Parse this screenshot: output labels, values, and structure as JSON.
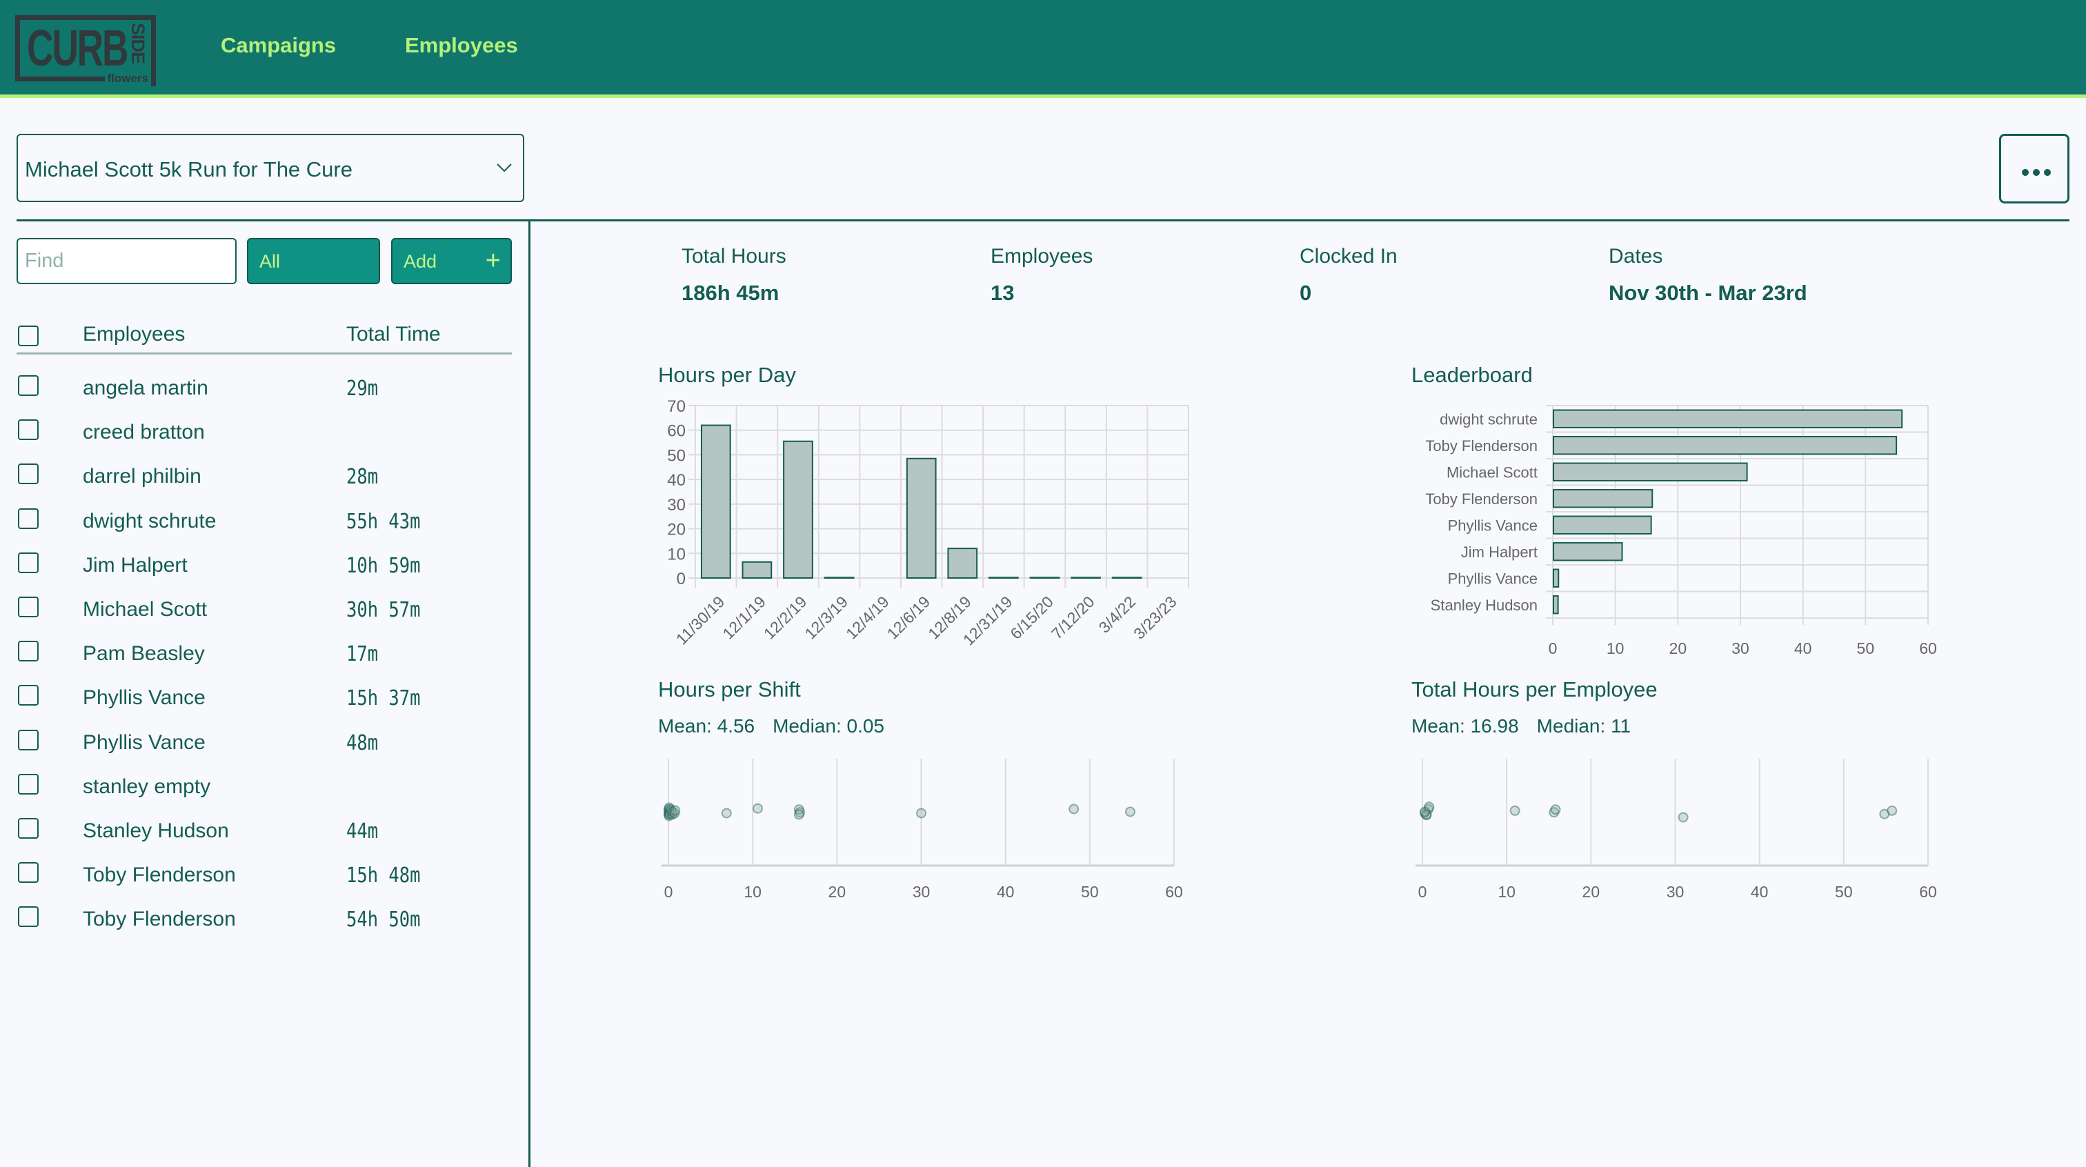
{
  "header": {
    "logo": {
      "main": "CURB",
      "side": "SIDE",
      "sub": "flowers"
    },
    "nav": [
      {
        "label": "Campaigns"
      },
      {
        "label": "Employees"
      }
    ]
  },
  "campaign_select": {
    "selected": "Michael Scott 5k Run for The Cure",
    "icon": "chevron-down-icon"
  },
  "more_button": {
    "icon": "more-horizontal-icon"
  },
  "sidebar": {
    "search": {
      "placeholder": "Find",
      "value": ""
    },
    "filter_button": {
      "label": "All"
    },
    "add_button": {
      "label": "Add",
      "icon": "plus-icon"
    },
    "columns": {
      "name": "Employees",
      "time": "Total Time"
    },
    "employees": [
      {
        "name": "angela martin",
        "time": "29m"
      },
      {
        "name": "creed bratton",
        "time": ""
      },
      {
        "name": "darrel philbin",
        "time": "28m"
      },
      {
        "name": "dwight schrute",
        "time": "55h 43m"
      },
      {
        "name": "Jim Halpert",
        "time": "10h 59m"
      },
      {
        "name": "Michael Scott",
        "time": "30h 57m"
      },
      {
        "name": "Pam Beasley",
        "time": "17m"
      },
      {
        "name": "Phyllis Vance",
        "time": "15h 37m"
      },
      {
        "name": "Phyllis Vance",
        "time": "48m"
      },
      {
        "name": "stanley empty",
        "time": ""
      },
      {
        "name": "Stanley Hudson",
        "time": "44m"
      },
      {
        "name": "Toby Flenderson",
        "time": "15h 48m"
      },
      {
        "name": "Toby Flenderson",
        "time": "54h 50m"
      }
    ]
  },
  "stats": [
    {
      "label": "Total Hours",
      "value": "186h 45m"
    },
    {
      "label": "Employees",
      "value": "13"
    },
    {
      "label": "Clocked In",
      "value": "0"
    },
    {
      "label": "Dates",
      "value": "Nov 30th - Mar 23rd"
    }
  ],
  "colors": {
    "primary": "#135d52",
    "header": "#10766c",
    "accent": "#b5f07a",
    "bar_fill": "#b5c5c3",
    "bar_stroke": "#135d52"
  },
  "chart_data": [
    {
      "id": "hours_per_day",
      "type": "bar",
      "title": "Hours per Day",
      "categories": [
        "11/30/19",
        "12/1/19",
        "12/2/19",
        "12/3/19",
        "12/4/19",
        "12/6/19",
        "12/8/19",
        "12/31/19",
        "6/15/20",
        "7/12/20",
        "3/4/22",
        "3/23/23"
      ],
      "values": [
        62,
        6.5,
        55.5,
        0.2,
        0,
        48.5,
        12,
        0.2,
        0.2,
        0.2,
        0.2,
        0
      ],
      "ylim": [
        0,
        70
      ],
      "yticks": [
        0,
        10,
        20,
        30,
        40,
        50,
        60,
        70
      ],
      "grid": true
    },
    {
      "id": "leaderboard",
      "type": "bar",
      "orientation": "horizontal",
      "title": "Leaderboard",
      "categories": [
        "dwight schrute",
        "Toby Flenderson",
        "Michael Scott",
        "Toby Flenderson",
        "Phyllis Vance",
        "Jim Halpert",
        "Phyllis Vance",
        "Stanley Hudson"
      ],
      "values": [
        55.72,
        54.83,
        30.95,
        15.8,
        15.62,
        10.98,
        0.8,
        0.73
      ],
      "xlim": [
        0,
        60
      ],
      "xticks": [
        0,
        10,
        20,
        30,
        40,
        50,
        60
      ],
      "grid": true
    },
    {
      "id": "hours_per_shift",
      "type": "scatter",
      "title": "Hours per Shift",
      "stats": {
        "mean_label": "Mean: 4.56",
        "median_label": "Median: 0.05"
      },
      "points": [
        0.02,
        0.03,
        0.05,
        0.05,
        0.08,
        0.1,
        0.15,
        0.2,
        0.3,
        0.48,
        0.5,
        0.73,
        0.8,
        6.9,
        10.6,
        15.5,
        15.6,
        15.5,
        30.0,
        48.1,
        54.8
      ],
      "jitter": [
        0.1,
        -0.1,
        0.05,
        -0.05,
        0.15,
        -0.15,
        0,
        0.08,
        -0.08,
        0.1,
        0,
        0.05,
        -0.05,
        0.05,
        -0.12,
        -0.08,
        0.02,
        0.1,
        0.05,
        -0.1,
        0
      ],
      "xlim": [
        0,
        60
      ],
      "xticks": [
        0,
        10,
        20,
        30,
        40,
        50,
        60
      ],
      "grid": true
    },
    {
      "id": "total_hours_per_employee",
      "type": "scatter",
      "title": "Total Hours per Employee",
      "stats": {
        "mean_label": "Mean: 16.98",
        "median_label": "Median: 11"
      },
      "points": [
        0.28,
        0.47,
        0.73,
        0.8,
        0.5,
        0.29,
        10.98,
        15.62,
        15.8,
        30.95,
        54.83,
        55.72
      ],
      "jitter": [
        0.05,
        0.12,
        -0.1,
        -0.18,
        0.1,
        0.0,
        -0.04,
        0.02,
        -0.08,
        0.2,
        0.08,
        -0.04
      ],
      "xlim": [
        0,
        60
      ],
      "xticks": [
        0,
        10,
        20,
        30,
        40,
        50,
        60
      ],
      "grid": true
    }
  ]
}
